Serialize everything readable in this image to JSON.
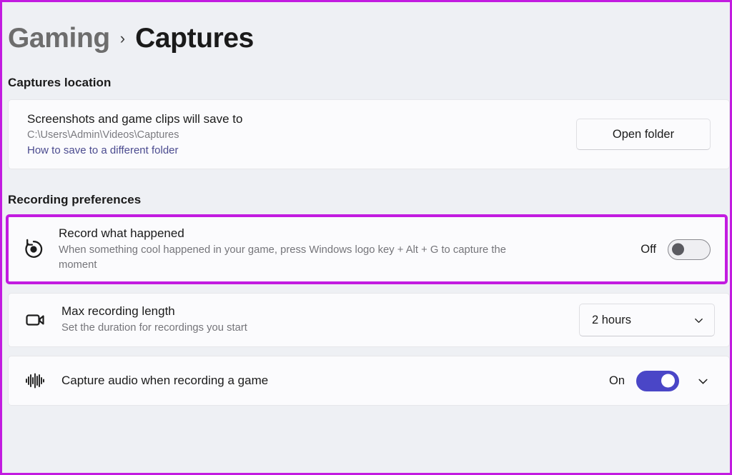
{
  "theme": {
    "page_background": "#eef0f4",
    "card_background": "#fbfbfd",
    "accent_toggle_on": "#4a46c7",
    "highlight_annotation": "#c21be0",
    "link_color": "#4b4b8f",
    "text_primary": "#1b1b1b",
    "text_secondary": "#75757a"
  },
  "breadcrumb": {
    "parent": "Gaming",
    "separator": "›",
    "current": "Captures"
  },
  "sections": {
    "captures_location": {
      "heading": "Captures location",
      "card": {
        "title": "Screenshots and game clips will save to",
        "path": "C:\\Users\\Admin\\Videos\\Captures",
        "link": "How to save to a different folder",
        "button": "Open folder"
      }
    },
    "recording_preferences": {
      "heading": "Recording preferences",
      "rows": [
        {
          "icon": "record-replay-icon",
          "title": "Record what happened",
          "description": "When something cool happened in your game, press Windows logo key + Alt + G to capture the moment",
          "state_label": "Off",
          "toggle_state": "off",
          "highlighted": true
        },
        {
          "icon": "video-camera-icon",
          "title": "Max recording length",
          "description": "Set the duration for recordings you start",
          "dropdown_value": "2 hours",
          "dropdown_chevron": "chevron-down-icon"
        },
        {
          "icon": "audio-waveform-icon",
          "title": "Capture audio when recording a game",
          "description": "",
          "state_label": "On",
          "toggle_state": "on",
          "expander": "chevron-down-icon"
        }
      ]
    }
  }
}
